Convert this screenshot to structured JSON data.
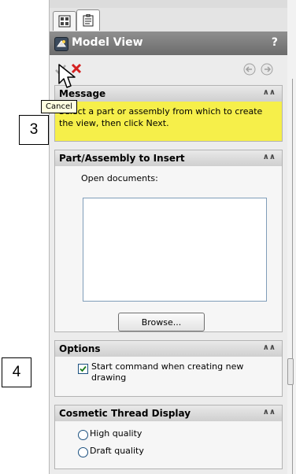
{
  "callouts": {
    "first": "3",
    "second": "4"
  },
  "panel": {
    "title": "Model View",
    "help": "?",
    "tabs": [
      {
        "icon": "feature-manager-icon"
      },
      {
        "icon": "property-manager-icon"
      }
    ]
  },
  "actions": {
    "ok_icon": "checkmark-icon",
    "cancel_icon": "cancel-x-icon",
    "back_icon": "back-arrow-icon",
    "next_icon": "next-arrow-icon",
    "tooltip": "Cancel"
  },
  "message": {
    "heading": "Message",
    "text": "Select a part or assembly from which to create the view, then click Next."
  },
  "part_assembly": {
    "heading": "Part/Assembly to Insert",
    "open_docs_label": "Open documents:",
    "browse_label": "Browse..."
  },
  "options": {
    "heading": "Options",
    "start_command_label": "Start command when creating new drawing",
    "start_command_checked": true
  },
  "cosmetic": {
    "heading": "Cosmetic Thread Display",
    "high_label": "High quality",
    "draft_label": "Draft quality"
  },
  "colors": {
    "message_bg": "#f6ef4a",
    "cancel_red": "#d42020",
    "title_bg": "#7a7a7a"
  }
}
